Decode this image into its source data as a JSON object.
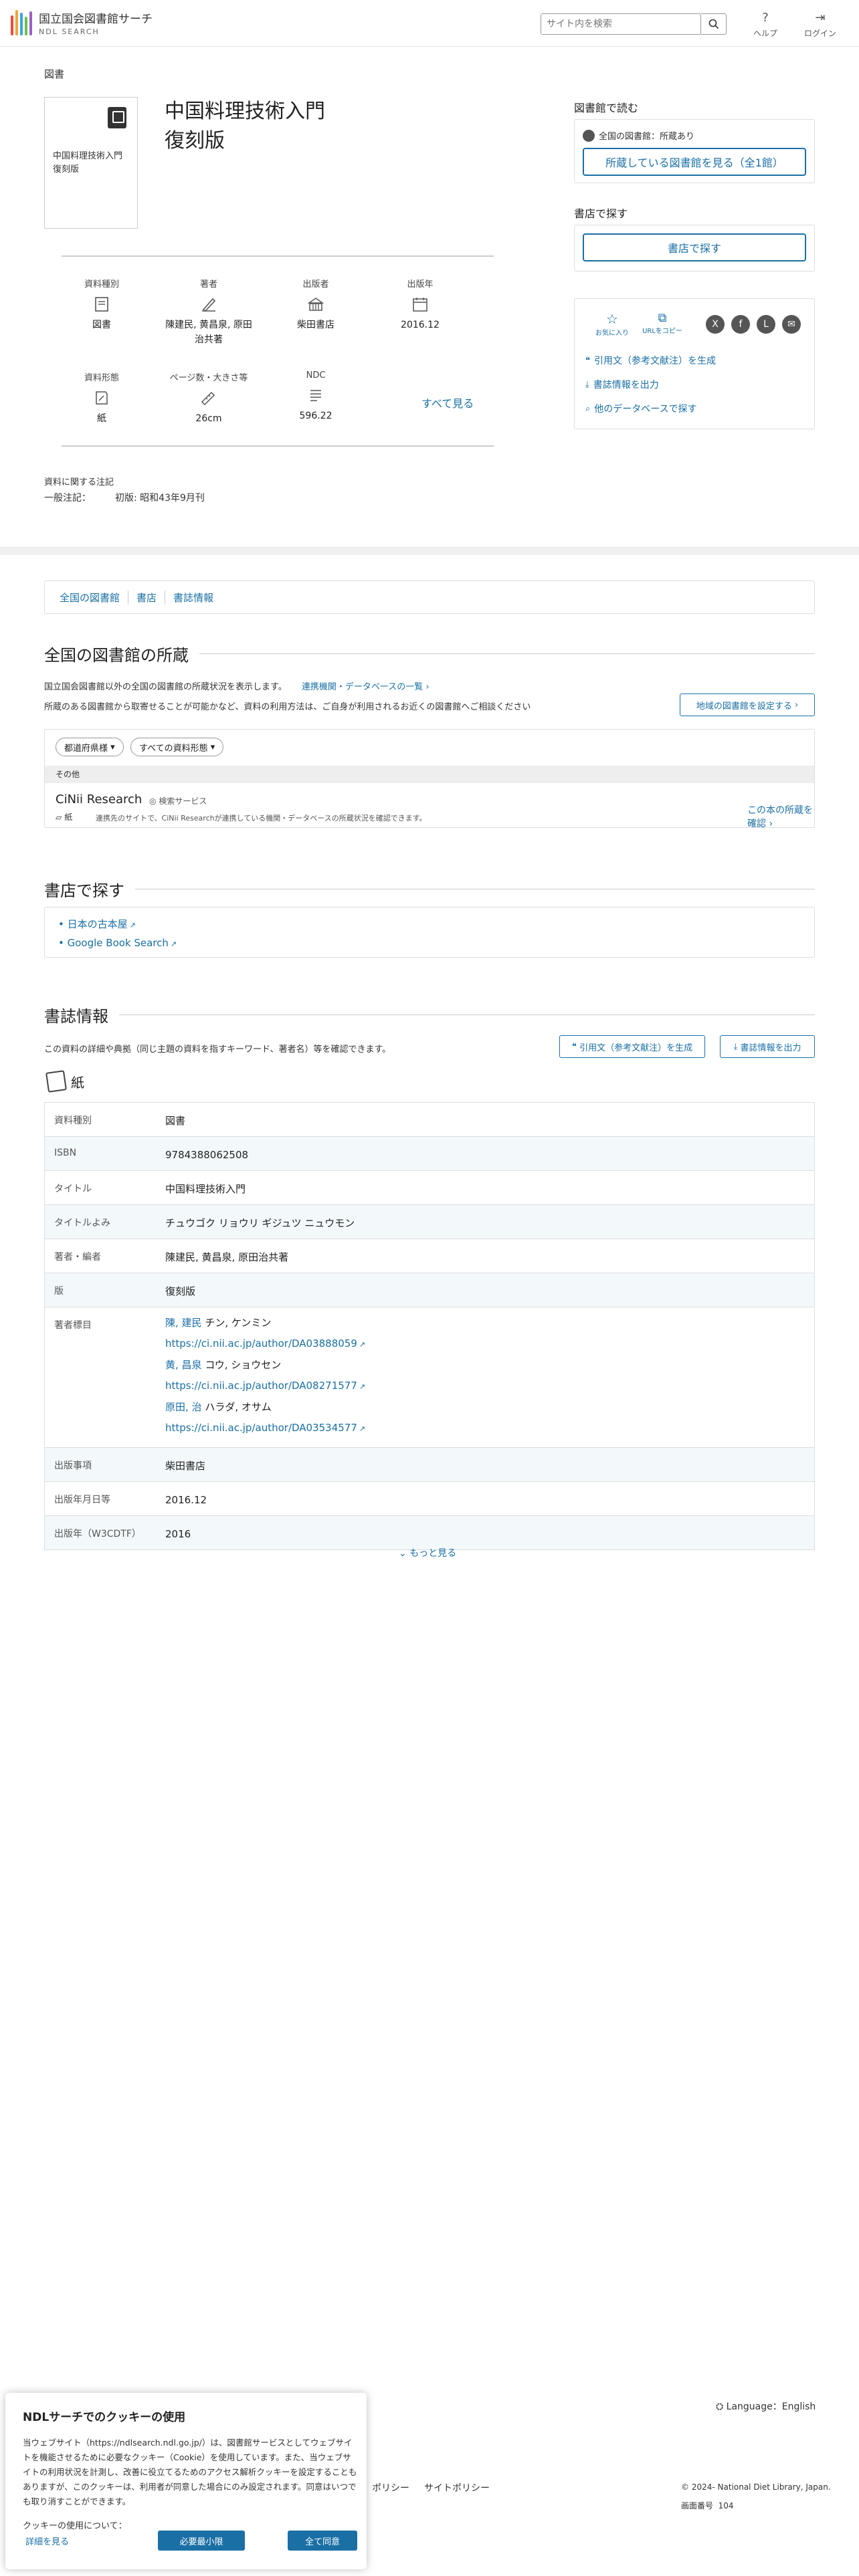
{
  "header": {
    "logo_ja": "国立国会図書館サーチ",
    "logo_en": "NDL SEARCH",
    "search_placeholder": "サイト内を検索",
    "help": "ヘルプ",
    "login": "ログイン"
  },
  "item": {
    "kind": "図書",
    "cover_title": "中国料理技術入門 復刻版",
    "title_line1": "中国料理技術入門",
    "title_line2": "復刻版",
    "meta": {
      "type_label": "資料種別",
      "type_value": "図書",
      "author_label": "著者",
      "author_value": "陳建民, 黄昌泉, 原田治共著",
      "publisher_label": "出版者",
      "publisher_value": "柴田書店",
      "year_label": "出版年",
      "year_value": "2016.12",
      "form_label": "資料形態",
      "form_value": "紙",
      "pages_label": "ページ数・大きさ等",
      "pages_value": "26cm",
      "ndc_label": "NDC",
      "ndc_value": "596.22",
      "see_all": "すべて見る"
    },
    "notes_head": "資料に関する注記",
    "notes_key": "一般注記：",
    "notes_value": "初版: 昭和43年9月刊"
  },
  "side": {
    "read_head": "図書館で読む",
    "holding_note": "全国の図書館：所蔵あり",
    "holding_btn": "所蔵している図書館を見る（全1館）",
    "shop_head": "書店で探す",
    "shop_btn": "書店で探す",
    "fav": "お気に入り",
    "copy_url": "URLをコピー",
    "cite": "引用文（参考文献注）を生成",
    "export": "書誌情報を出力",
    "other_db": "他のデータベースで探す"
  },
  "anchors": [
    "全国の図書館",
    "書店",
    "書誌情報"
  ],
  "libraries": {
    "title": "全国の図書館の所蔵",
    "desc1": "国立国会図書館以外の全国の図書館の所蔵状況を表示します。",
    "desc1_link": "連携機関・データベースの一覧",
    "desc2": "所蔵のある図書館から取寄せることが可能かなど、資料の利用方法は、ご自身が利用されるお近くの図書館へご相談ください",
    "region_btn": "地域の図書館を設定する",
    "pill_pref": "都道府県様",
    "pill_type": "すべての資料形態",
    "group": "その他",
    "cinii_name": "CiNii Research",
    "cinii_tag": "検索サービス",
    "cinii_type": "紙",
    "cinii_note": "連携先のサイトで、CiNii Researchが連携している機関・データベースの所蔵状況を確認できます。",
    "cinii_link": "この本の所蔵を確認"
  },
  "shop": {
    "title": "書店で探す",
    "links": [
      "日本の古本屋",
      "Google Book Search"
    ]
  },
  "bib": {
    "title": "書誌情報",
    "desc": "この資料の詳細や典拠（同じ主題の資料を指すキーワード、著者名）等を確認できます。",
    "cite_btn": "引用文（参考文献注）を生成",
    "export_btn": "書誌情報を出力",
    "paper": "紙",
    "rows": [
      {
        "k": "資料種別",
        "v": "図書"
      },
      {
        "k": "ISBN",
        "v": "9784388062508"
      },
      {
        "k": "タイトル",
        "v": "中国料理技術入門"
      },
      {
        "k": "タイトルよみ",
        "v": "チュウゴク リョウリ ギジュツ ニュウモン"
      },
      {
        "k": "著者・編者",
        "v": "陳建民, 黄昌泉, 原田治共著"
      },
      {
        "k": "版",
        "v": "復刻版"
      }
    ],
    "authors_key": "著者標目",
    "authors": [
      {
        "name": "陳, 建民",
        "yomi": "チン, ケンミン",
        "url": "https://ci.nii.ac.jp/author/DA03888059"
      },
      {
        "name": "黄, 昌泉",
        "yomi": "コウ, ショウセン",
        "url": "https://ci.nii.ac.jp/author/DA08271577"
      },
      {
        "name": "原田, 治",
        "yomi": "ハラダ, オサム",
        "url": "https://ci.nii.ac.jp/author/DA03534577"
      }
    ],
    "rows2": [
      {
        "k": "出版事項",
        "v": "柴田書店"
      },
      {
        "k": "出版年月日等",
        "v": "2016.12"
      },
      {
        "k": "出版年（W3CDTF）",
        "v": "2016"
      }
    ],
    "more": "もっと見る"
  },
  "footer": {
    "lang": "Language：English",
    "policy1": "ポリシー",
    "policy2": "サイトポリシー",
    "copyright": "© 2024- National Diet Library, Japan.",
    "pageno_label": "画面番号",
    "pageno": "104"
  },
  "cookie": {
    "title": "NDLサーチでのクッキーの使用",
    "body": "当ウェブサイト（https://ndlsearch.ndl.go.jp/）は、図書館サービスとしてウェブサイトを機能させるために必要なクッキー（Cookie）を使用しています。また、当ウェブサイトの利用状況を計測し、改善に役立てるためのアクセス解析クッキーを設定することもありますが、このクッキーは、利用者が同意した場合にのみ設定されます。同意はいつでも取り消すことができます。",
    "about": "クッキーの使用について：",
    "detail": "詳細を見る",
    "minimal": "必要最小限",
    "accept": "全て同意"
  },
  "colors": {
    "accent": "#1a6fa5"
  }
}
